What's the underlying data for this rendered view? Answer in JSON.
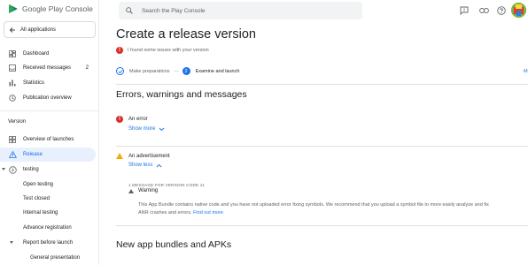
{
  "app": {
    "logo_text_main": "Google Play",
    "logo_text_sub": "Console"
  },
  "search": {
    "placeholder": "Search the Play Console"
  },
  "sidebar": {
    "all_apps": "All applications",
    "items": [
      {
        "label": "Dashboard"
      },
      {
        "label": "Received messages",
        "badge": "2"
      },
      {
        "label": "Statistics"
      },
      {
        "label": "Publication overview"
      }
    ],
    "section_version": "Version",
    "version_items": [
      {
        "label": "Overview of launches"
      },
      {
        "label": "Release"
      },
      {
        "label": "testing"
      },
      {
        "label": "Open testing"
      },
      {
        "label": "Test closed"
      },
      {
        "label": "Internal testing"
      },
      {
        "label": "Advance registration"
      },
      {
        "label": "Report before launch"
      },
      {
        "label": "General presentation"
      }
    ]
  },
  "main": {
    "title": "Create a release version",
    "issue_text": "I found some issues with your version",
    "steps": [
      {
        "label": "Make preparations"
      },
      {
        "number": "2",
        "label": "Examine and launch"
      }
    ],
    "right_peek": "Ma",
    "errors_title": "Errors, warnings and messages",
    "error_row": {
      "label": "An error",
      "toggle": "Show more"
    },
    "ad_row": {
      "label": "An advertisement",
      "toggle": "Show less"
    },
    "detail": {
      "head": "1 MESSAGE FOR VERSION CODE 11",
      "warning_label": "Warning",
      "body": "This App Bundle contains native code and you have not uploaded error fixing symbols. We recommend that you upload a symbol file to more easily analyze and fix ANR crashes and errors.",
      "link": "Find out more"
    },
    "bundles_title": "New app bundles and APKs"
  },
  "colors": {
    "accent": "#1a73e8",
    "error": "#d93025",
    "warning": "#f9ab00"
  }
}
